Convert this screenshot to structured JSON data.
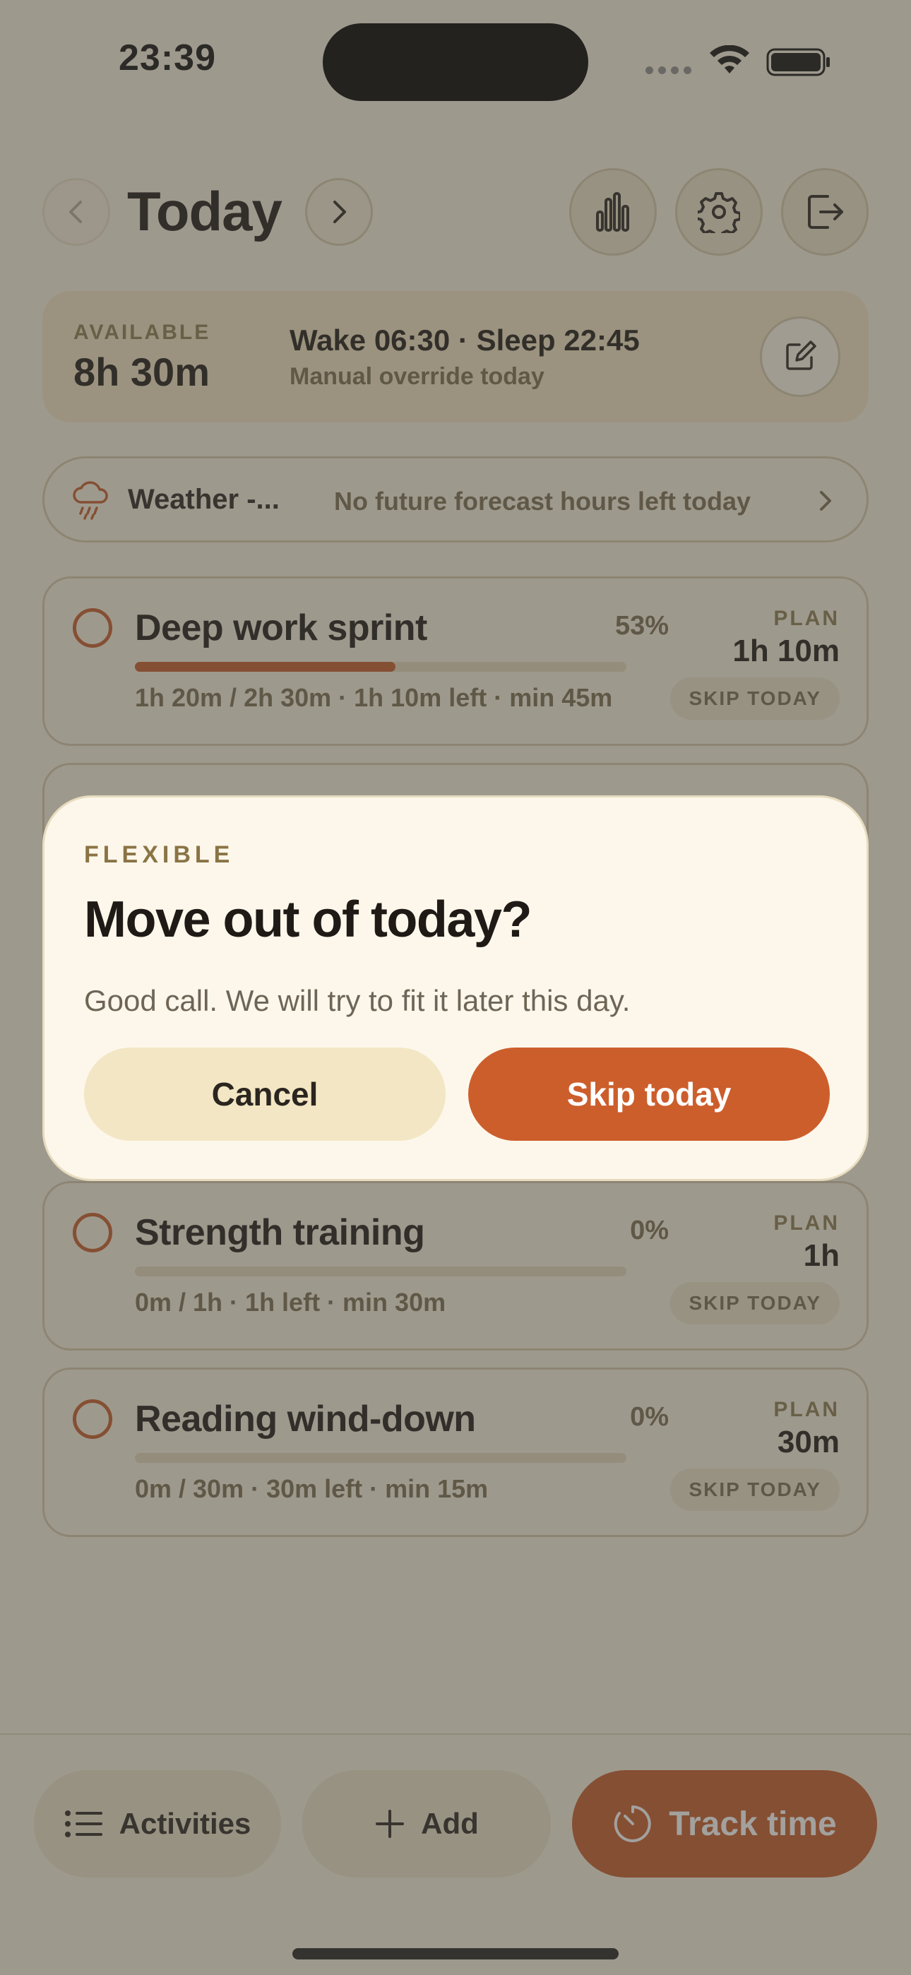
{
  "status_bar": {
    "time": "23:39"
  },
  "header": {
    "title": "Today"
  },
  "header_icons": {
    "prev": "chevron-left-icon",
    "next": "chevron-right-icon",
    "stats": "bar-chart-icon",
    "settings": "gear-icon",
    "logout": "logout-icon"
  },
  "availability": {
    "label": "AVAILABLE",
    "value": "8h 30m",
    "schedule": "Wake 06:30 · Sleep 22:45",
    "note": "Manual override today"
  },
  "weather": {
    "title": "Weather -...",
    "message": "No future forecast hours left today"
  },
  "activities": [
    {
      "name": "Deep work sprint",
      "percent": "53%",
      "progress": 0.53,
      "meta": "1h 20m / 2h 30m · 1h 10m left · min 45m",
      "plan_label": "PLAN",
      "plan_value": "1h 10m",
      "skip_label": "SKIP TODAY"
    },
    {
      "name": "Strength training",
      "percent": "0%",
      "progress": 0,
      "meta": "0m / 1h · 1h left · min 30m",
      "plan_label": "PLAN",
      "plan_value": "1h",
      "skip_label": "SKIP TODAY"
    },
    {
      "name": "Reading wind-down",
      "percent": "0%",
      "progress": 0,
      "meta": "0m / 30m · 30m left · min 15m",
      "plan_label": "PLAN",
      "plan_value": "30m",
      "skip_label": "SKIP TODAY"
    }
  ],
  "bottom_bar": {
    "activities_label": "Activities",
    "add_label": "Add",
    "track_label": "Track time"
  },
  "dialog": {
    "eyebrow": "FLEXIBLE",
    "title": "Move out of today?",
    "body": "Good call. We will try to fit it later this day.",
    "cancel_label": "Cancel",
    "confirm_label": "Skip today"
  },
  "colors": {
    "accent": "#c55a28",
    "background": "#f6eedd",
    "dialog_background": "#fdf7eb"
  }
}
